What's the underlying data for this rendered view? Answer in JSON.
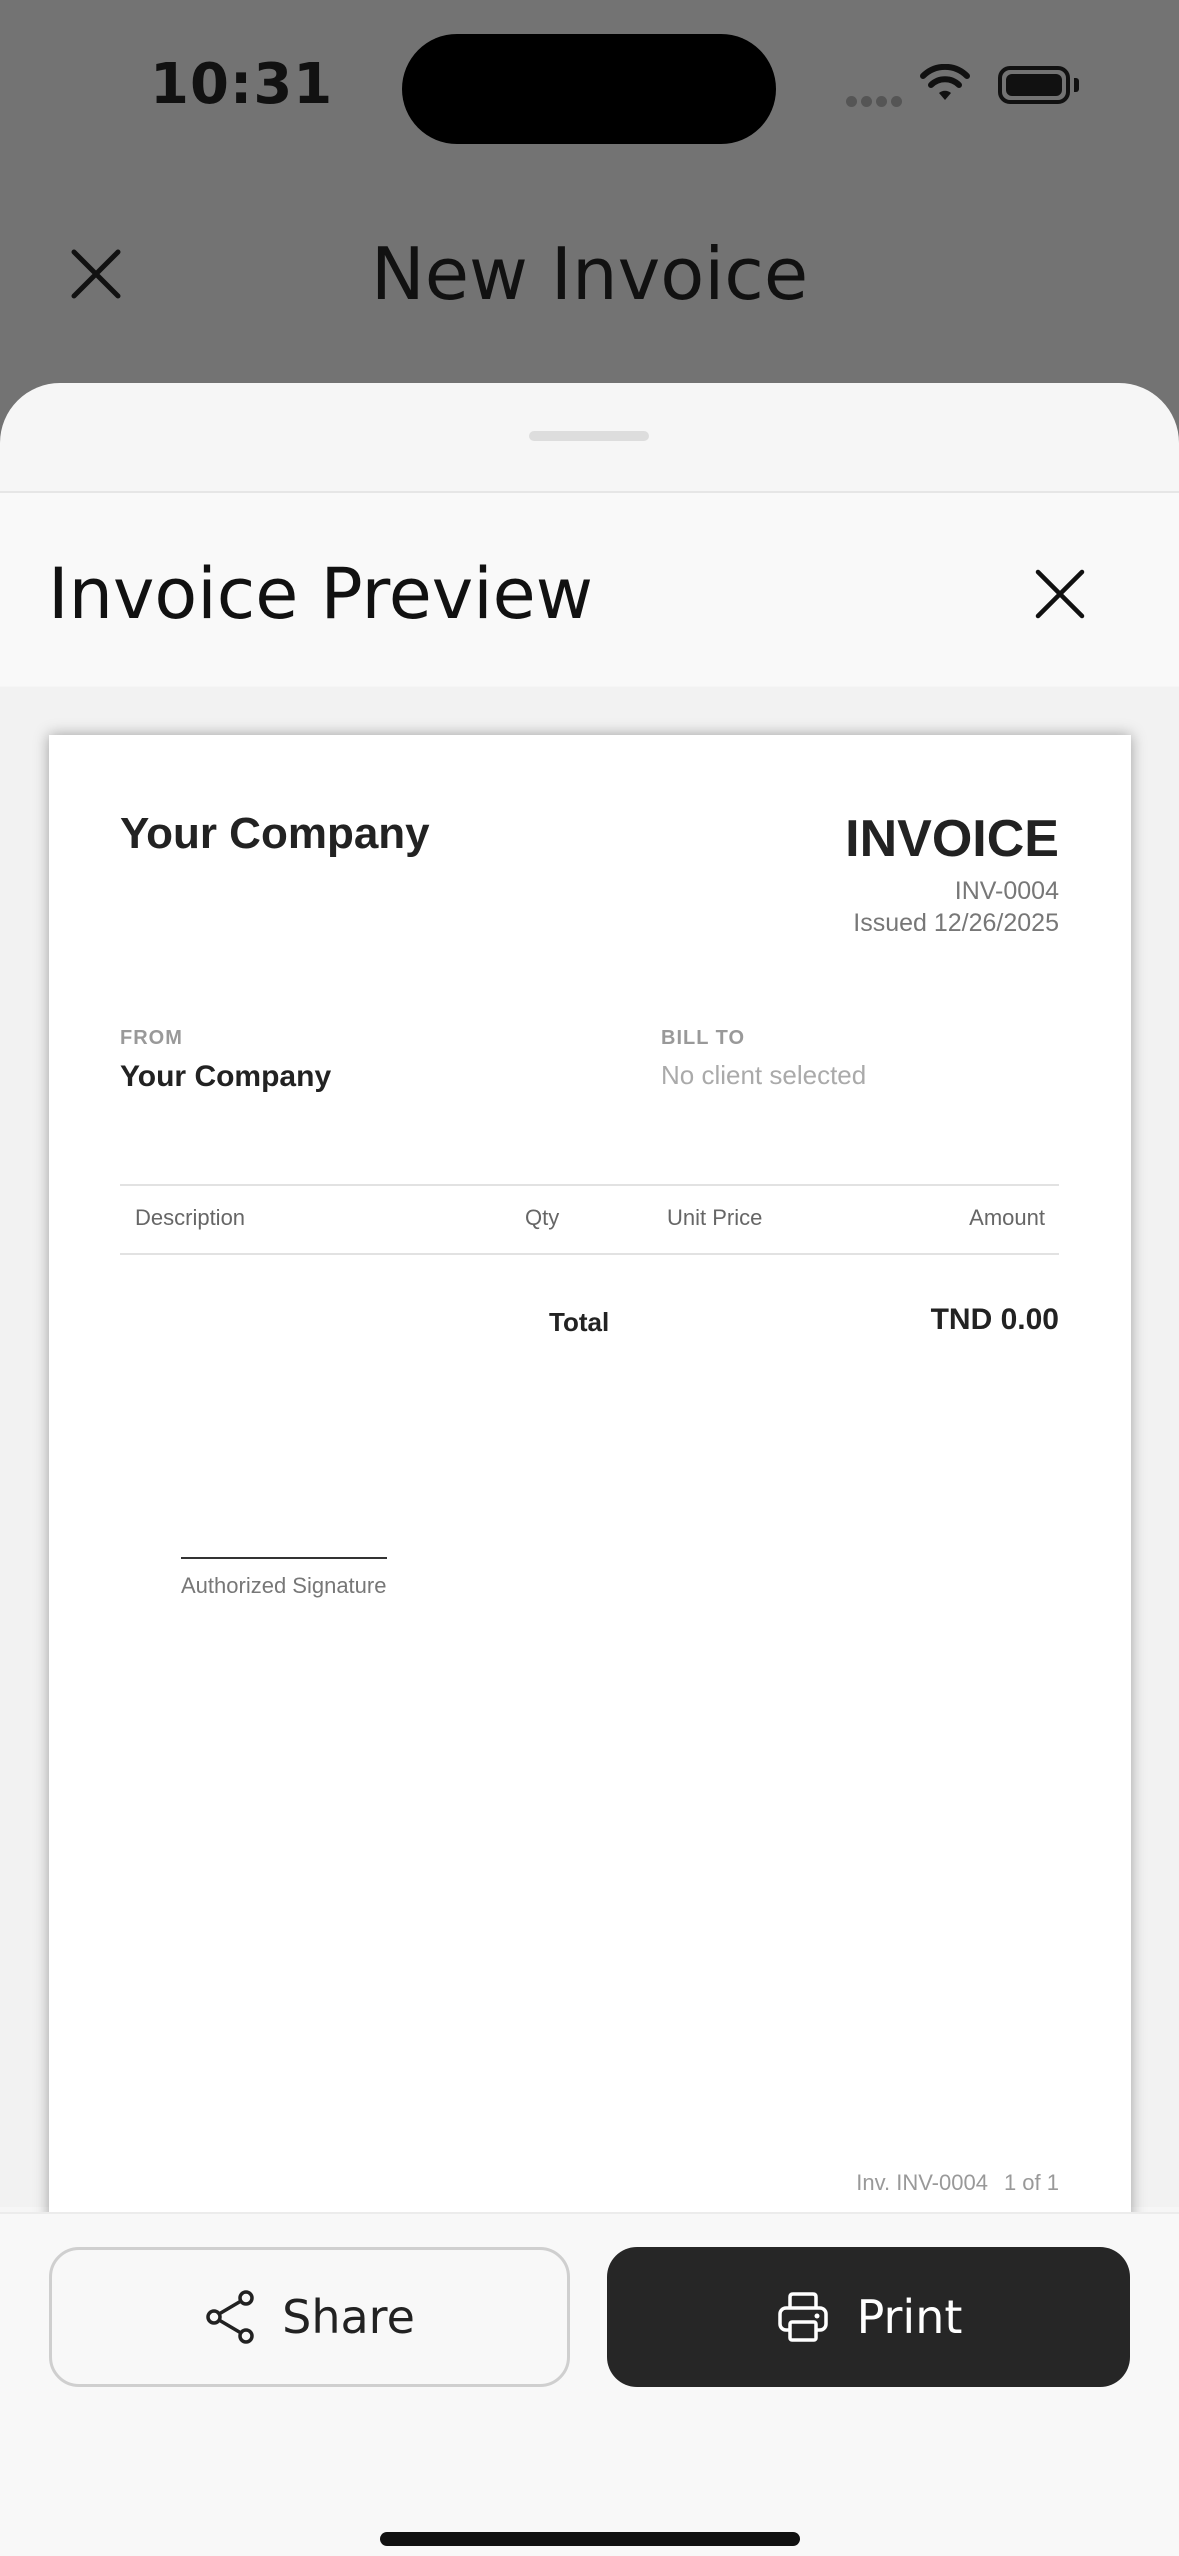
{
  "status_bar": {
    "time": "10:31"
  },
  "background": {
    "title": "New Invoice"
  },
  "sheet": {
    "title": "Invoice Preview"
  },
  "invoice": {
    "company": "Your Company",
    "heading": "INVOICE",
    "number": "INV-0004",
    "issued": "Issued 12/26/2025",
    "from_label": "FROM",
    "from_name": "Your Company",
    "bill_to_label": "BILL TO",
    "bill_to_value": "No client selected",
    "columns": [
      "Description",
      "Qty",
      "Unit Price",
      "Amount"
    ],
    "total_label": "Total",
    "total_value": "TND 0.00",
    "signature_label": "Authorized Signature",
    "footer_ref": "Inv. INV-0004",
    "footer_page": "1 of 1"
  },
  "actions": {
    "share_label": "Share",
    "print_label": "Print"
  },
  "icons": {
    "background_close": "close-icon",
    "sheet_close": "close-icon",
    "share": "share-icon",
    "print": "printer-icon"
  }
}
